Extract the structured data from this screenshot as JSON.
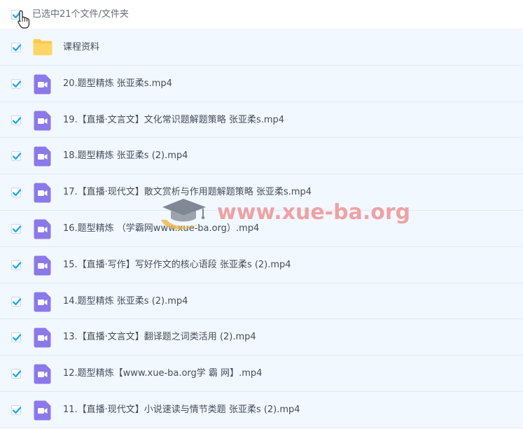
{
  "header": {
    "selection_label": "已选中21个文件/文件夹"
  },
  "watermark": {
    "text": "www.xue-ba.org"
  },
  "rows": [
    {
      "type": "folder",
      "name": "课程资料"
    },
    {
      "type": "video",
      "name": "20.题型精炼 张亚柔s.mp4"
    },
    {
      "type": "video",
      "name": "19.【直播·文言文】文化常识题解题策略 张亚柔s.mp4"
    },
    {
      "type": "video",
      "name": "18.题型精炼 张亚柔s (2).mp4"
    },
    {
      "type": "video",
      "name": "17.【直播·现代文】散文赏析与作用题解题策略 张亚柔s.mp4"
    },
    {
      "type": "video",
      "name": "16.题型精炼 （学霸网www.xue-ba.org）.mp4"
    },
    {
      "type": "video",
      "name": "15.【直播·写作】写好作文的核心语段 张亚柔s (2).mp4"
    },
    {
      "type": "video",
      "name": "14.题型精炼 张亚柔s (2).mp4"
    },
    {
      "type": "video",
      "name": "13.【直播·文言文】翻译题之词类活用 (2).mp4"
    },
    {
      "type": "video",
      "name": "12.题型精炼【www.xue-ba.org学 霸 网】.mp4"
    },
    {
      "type": "video",
      "name": "11.【直播·现代文】小说速读与情节类题 张亚柔s (2).mp4"
    }
  ],
  "colors": {
    "accent": "#06a7ff",
    "row_selected_bg": "#f2f8ff",
    "video_icon": "#8b79e9",
    "folder_icon": "#ffc94d"
  }
}
